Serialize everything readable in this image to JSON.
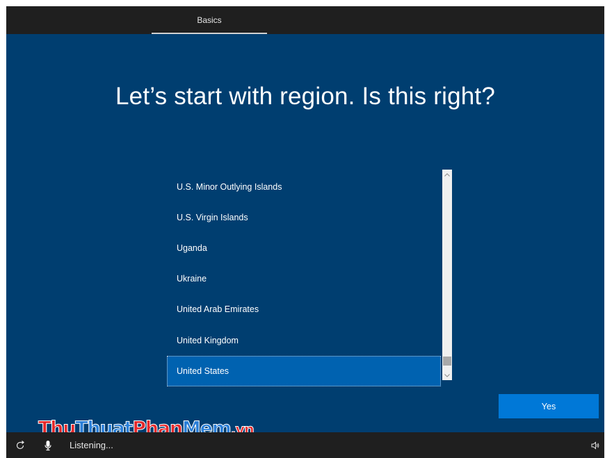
{
  "header": {
    "tabs": [
      {
        "label": "Basics",
        "active": true
      }
    ]
  },
  "main": {
    "title": "Let’s start with region. Is this right?",
    "region_list": {
      "items": [
        "U.S. Minor Outlying Islands",
        "U.S. Virgin Islands",
        "Uganda",
        "Ukraine",
        "United Arab Emirates",
        "United Kingdom",
        "United States"
      ],
      "selected": "United States"
    },
    "yes_label": "Yes"
  },
  "watermark": {
    "part1": "Thu",
    "part2": "Thuat",
    "part3": "Phan",
    "part4": "Mem",
    "part5": ".vn"
  },
  "footer": {
    "listening_text": "Listening...",
    "icons": [
      "ease-of-access-icon",
      "microphone-icon",
      "volume-icon"
    ]
  },
  "colors": {
    "background": "#003e70",
    "selected_item": "#0062b0",
    "primary_button": "#0078d7",
    "bars": "#1f1f1f"
  }
}
